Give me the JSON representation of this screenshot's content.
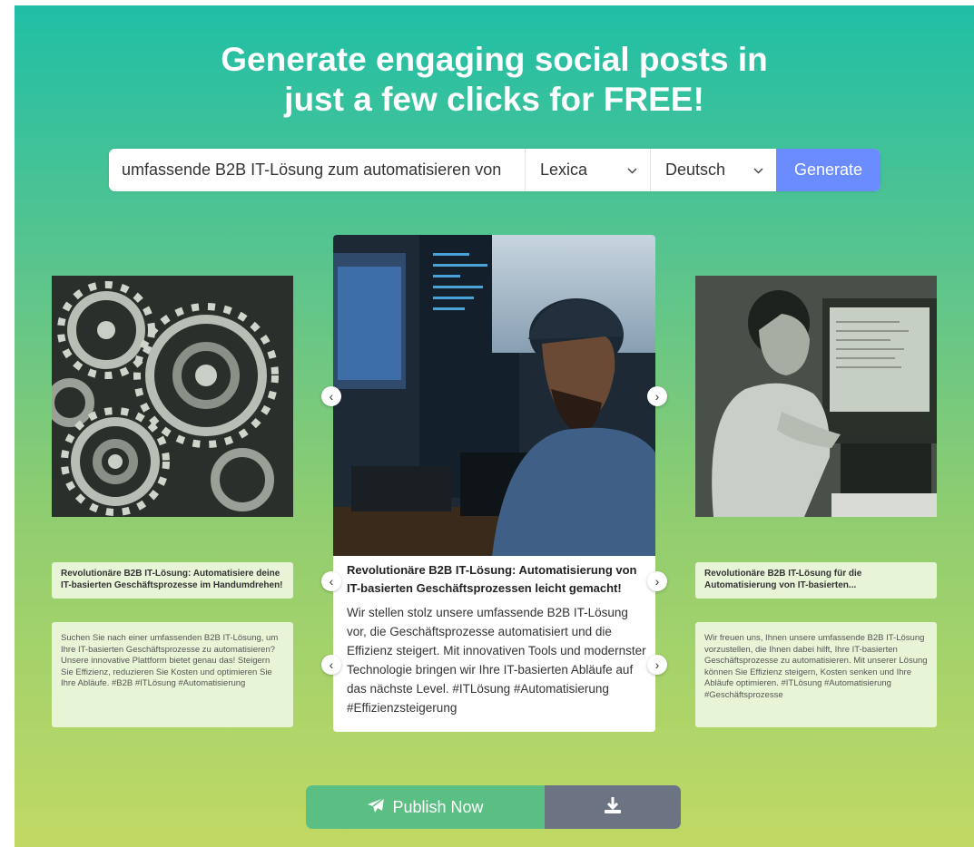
{
  "headline": {
    "line1": "Generate engaging social posts in",
    "line2": "just a few clicks for FREE!"
  },
  "search": {
    "value": "umfassende B2B IT-Lösung zum automatisieren von",
    "source": "Lexica",
    "language": "Deutsch",
    "generate_label": "Generate"
  },
  "cards": {
    "left": {
      "title": "Revolutionäre B2B IT-Lösung: Automatisiere deine IT-basierten Geschäftsprozesse im Handumdrehen!",
      "body": "Suchen Sie nach einer umfassenden B2B IT-Lösung, um Ihre IT-basierten Geschäftsprozesse zu automatisieren? Unsere innovative Plattform bietet genau das! Steigern Sie Effizienz, reduzieren Sie Kosten und optimieren Sie Ihre Abläufe. #B2B #ITLösung #Automatisierung"
    },
    "center": {
      "title": "Revolutionäre B2B IT-Lösung: Automatisierung von IT-basierten Geschäftsprozessen leicht gemacht!",
      "body": "Wir stellen stolz unsere umfassende B2B IT-Lösung vor, die Geschäftsprozesse automatisiert und die Effizienz steigert. Mit innovativen Tools und modernster Technologie bringen wir Ihre IT-basierten Abläufe auf das nächste Level. #ITLösung #Automatisierung #Effizienzsteigerung"
    },
    "right": {
      "title": "Revolutionäre B2B IT-Lösung für die Automatisierung von IT-basierten...",
      "body": "Wir freuen uns, Ihnen unsere umfassende B2B IT-Lösung vorzustellen, die Ihnen dabei hilft, Ihre IT-basierten Geschäftsprozesse zu automatisieren. Mit unserer Lösung können Sie Effizienz steigern, Kosten senken und Ihre Abläufe optimieren. #ITLösung #Automatisierung #Geschäftsprozesse"
    }
  },
  "arrows": {
    "prev": "‹",
    "next": "›"
  },
  "actions": {
    "publish_label": "Publish Now"
  },
  "icons": {
    "publish": "paper-plane-icon",
    "download": "download-icon",
    "prev": "chevron-left-icon",
    "next": "chevron-right-icon",
    "select": "chevron-down-icon"
  },
  "colors": {
    "generate_button": "#6b8cff",
    "publish_button": "#5bbf83",
    "download_button": "#6c7483"
  }
}
